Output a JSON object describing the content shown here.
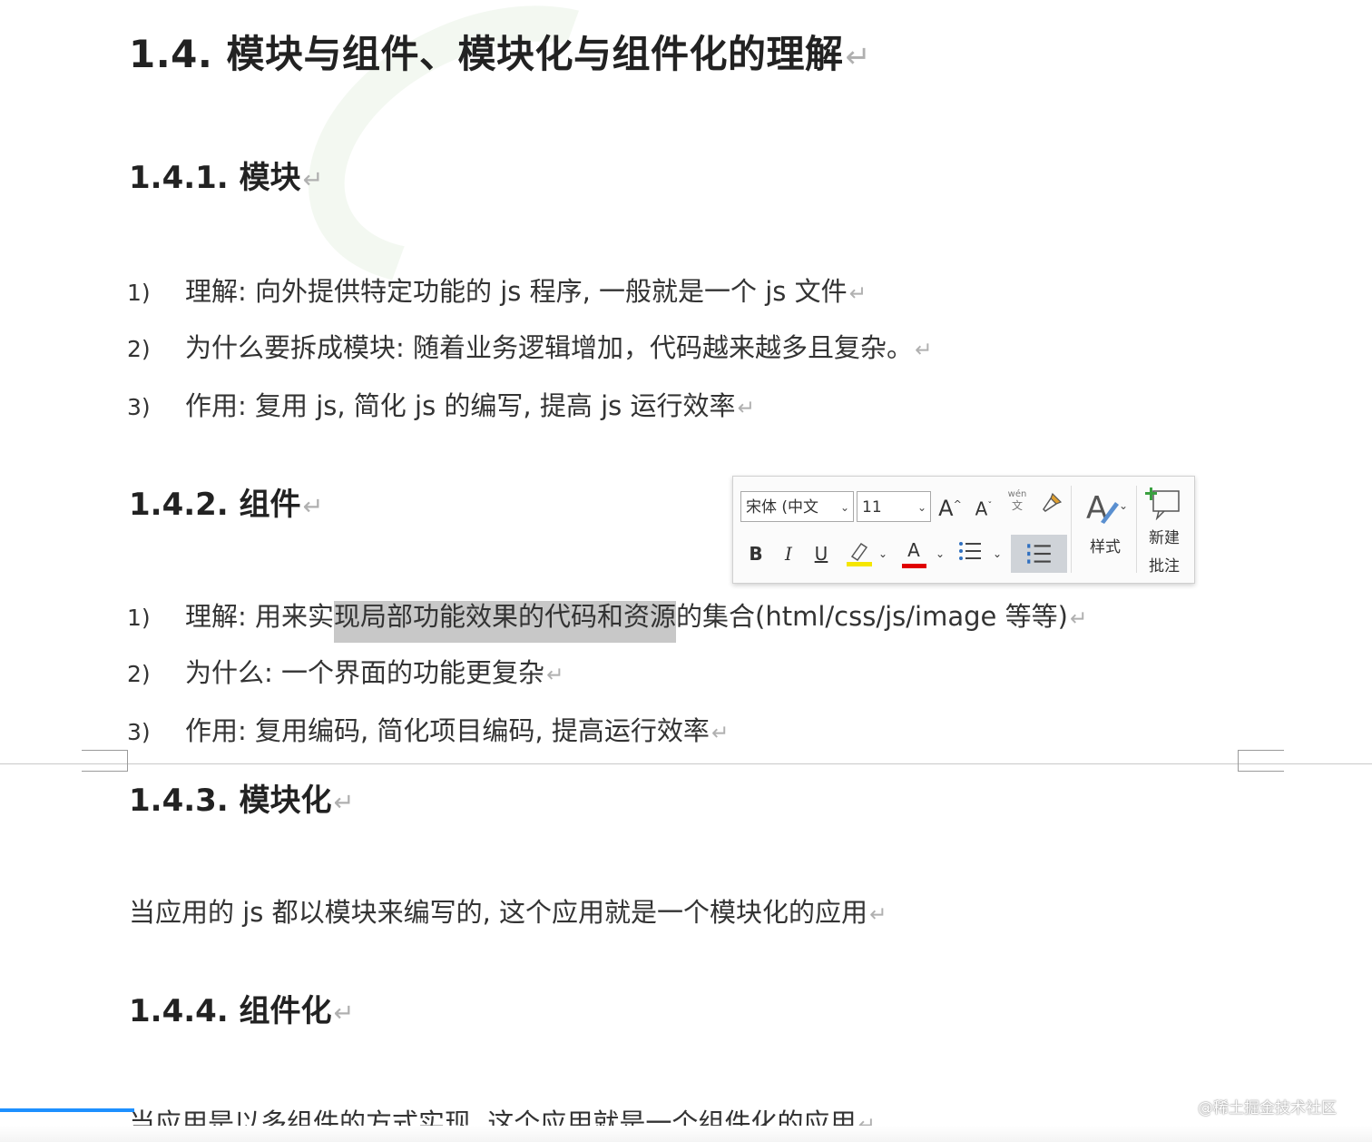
{
  "document": {
    "title": "1.4. 模块与组件、模块化与组件化的理解",
    "para_mark": "↵",
    "sections": [
      {
        "heading": "1.4.1. 模块",
        "items": [
          {
            "num": "1)",
            "text": "理解: 向外提供特定功能的 js 程序, 一般就是一个 js 文件"
          },
          {
            "num": "2)",
            "text": "为什么要拆成模块: 随着业务逻辑增加，代码越来越多且复杂。"
          },
          {
            "num": "3)",
            "text": "作用: 复用 js, 简化 js 的编写, 提高 js 运行效率"
          }
        ]
      },
      {
        "heading": "1.4.2. 组件",
        "items": [
          {
            "num": "1)",
            "text_before": "理解: 用来实",
            "text_selected": "现局部功能效果的代码和资源",
            "text_after": "的集合(html/css/js/image 等等)"
          },
          {
            "num": "2)",
            "text": "为什么: 一个界面的功能更复杂"
          },
          {
            "num": "3)",
            "text": "作用: 复用编码, 简化项目编码, 提高运行效率"
          }
        ]
      },
      {
        "heading": "1.4.3. 模块化",
        "body": "当应用的 js 都以模块来编写的, 这个应用就是一个模块化的应用"
      },
      {
        "heading": "1.4.4. 组件化",
        "body": "当应用是以多组件的方式实现, 这个应用就是一个组件化的应用"
      }
    ]
  },
  "mini_toolbar": {
    "font_name": "宋体 (中文",
    "font_size": "11",
    "grow_font_label": "A",
    "shrink_font_label": "A",
    "phonetic_label": "wén",
    "bold_label": "B",
    "italic_label": "I",
    "underline_label": "U",
    "font_color_label": "A",
    "styles_label": "样式",
    "new_comment_label_1": "新建",
    "new_comment_label_2": "批注",
    "highlight_color": "#f5e600",
    "font_color": "#e00000"
  },
  "watermark": {
    "attribution": "@稀土掘金技术社区"
  }
}
